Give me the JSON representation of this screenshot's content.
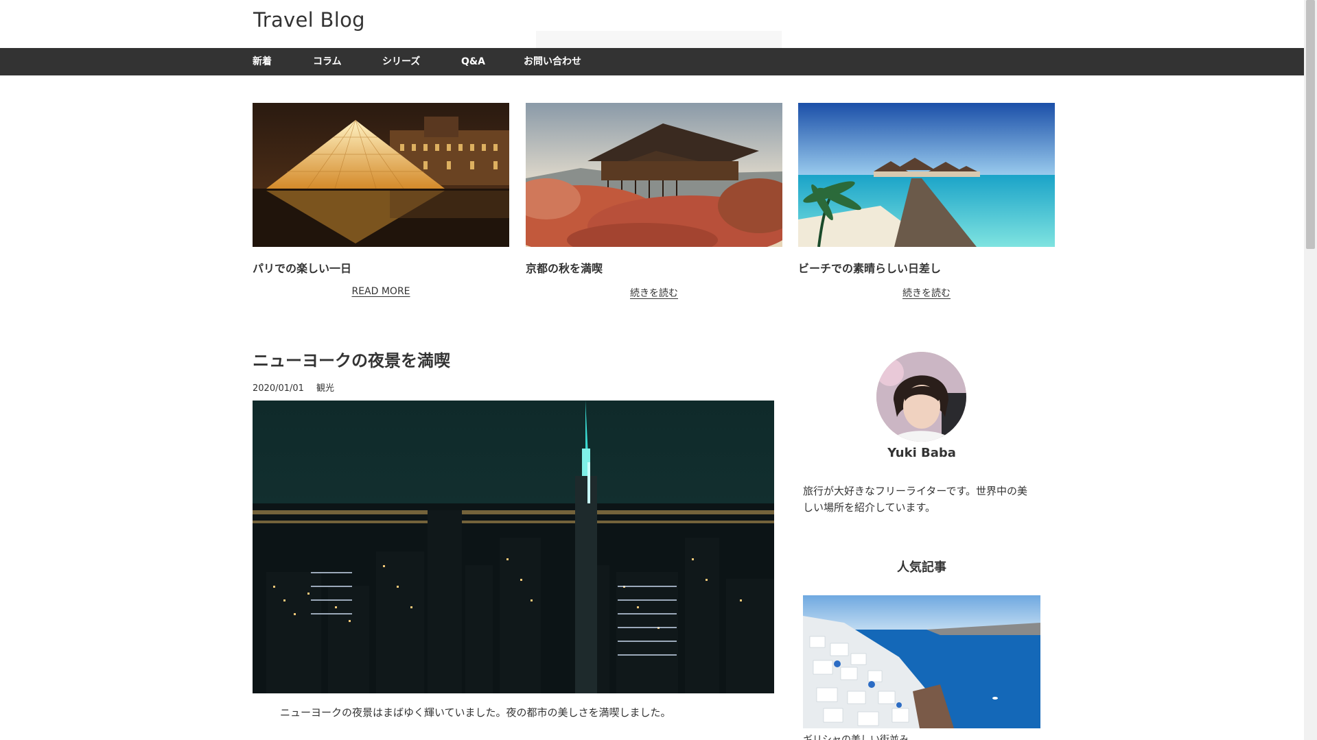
{
  "site": {
    "title": "Travel Blog"
  },
  "nav": {
    "items": [
      {
        "label": "新着"
      },
      {
        "label": "コラム"
      },
      {
        "label": "シリーズ"
      },
      {
        "label": "Q&A"
      },
      {
        "label": "お問い合わせ"
      }
    ]
  },
  "featured": [
    {
      "title": "パリでの楽しい一日",
      "more": "READ MORE",
      "image": "louvre-pyramid-night"
    },
    {
      "title": "京都の秋を満喫",
      "more": "続きを読む",
      "image": "kiyomizu-temple-autumn"
    },
    {
      "title": "ビーチでの素晴らしい日差し",
      "more": "続きを読む",
      "image": "tropical-beach-pier"
    }
  ],
  "article": {
    "title": "ニューヨークの夜景を満喫",
    "date": "2020/01/01",
    "category": "観光",
    "body": "ニューヨークの夜景はまばゆく輝いていました。夜の都市の美しさを満喫しました。",
    "image": "new-york-night-skyline"
  },
  "sidebar": {
    "profile": {
      "name": "Yuki Baba",
      "bio": "旅行が大好きなフリーライターです。世界中の美しい場所を紹介しています。"
    },
    "popular": {
      "heading": "人気記事",
      "caption": "ギリシャの美しい街並み",
      "image": "santorini-village"
    }
  },
  "colors": {
    "nav_bg": "#333333",
    "nav_text": "#ffffff",
    "text": "#333333",
    "background": "#ffffff"
  }
}
